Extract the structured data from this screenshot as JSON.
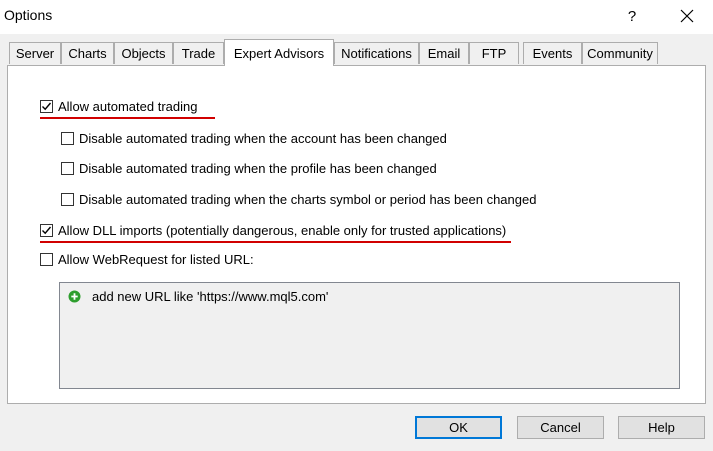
{
  "window": {
    "title": "Options",
    "help_label": "?"
  },
  "tabs": [
    {
      "label": "Server"
    },
    {
      "label": "Charts"
    },
    {
      "label": "Objects"
    },
    {
      "label": "Trade"
    },
    {
      "label": "Expert Advisors",
      "active": true
    },
    {
      "label": "Notifications"
    },
    {
      "label": "Email"
    },
    {
      "label": "FTP"
    },
    {
      "label": "Events"
    },
    {
      "label": "Community"
    }
  ],
  "options": {
    "allow_automated_trading": {
      "label": "Allow automated trading",
      "checked": true
    },
    "disable_on_account_change": {
      "label": "Disable automated trading when the account has been changed",
      "checked": false
    },
    "disable_on_profile_change": {
      "label": "Disable automated trading when the profile has been changed",
      "checked": false
    },
    "disable_on_symbol_change": {
      "label": "Disable automated trading when the charts symbol or period has been changed",
      "checked": false
    },
    "allow_dll_imports": {
      "label": "Allow DLL imports (potentially dangerous, enable only for trusted applications)",
      "checked": true
    },
    "allow_webrequest": {
      "label": "Allow WebRequest for listed URL:",
      "checked": false
    }
  },
  "url_list": {
    "add_item_label": "add new URL like 'https://www.mql5.com'"
  },
  "buttons": {
    "ok": "OK",
    "cancel": "Cancel",
    "help": "Help"
  },
  "colors": {
    "highlight_underline": "#d10000",
    "add_icon_green": "#2e9e2e",
    "default_button_border": "#0078d7"
  }
}
